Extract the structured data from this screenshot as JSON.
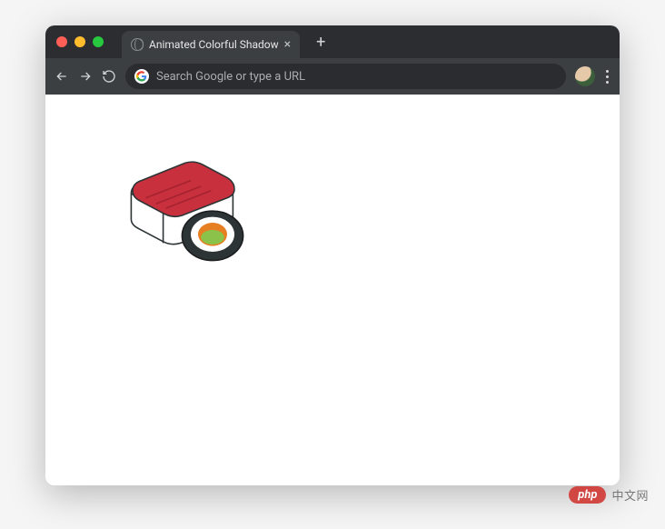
{
  "tab": {
    "title": "Animated Colorful Shadow"
  },
  "address_bar": {
    "placeholder": "Search Google or type a URL"
  },
  "watermark": {
    "badge": "php",
    "text": "中文网"
  },
  "icons": {
    "close": "close-icon",
    "new_tab": "plus-icon",
    "back": "back-icon",
    "forward": "forward-icon",
    "reload": "reload-icon",
    "google": "google-icon",
    "avatar": "avatar-icon",
    "menu": "kebab-menu-icon",
    "favicon": "globe-icon"
  }
}
